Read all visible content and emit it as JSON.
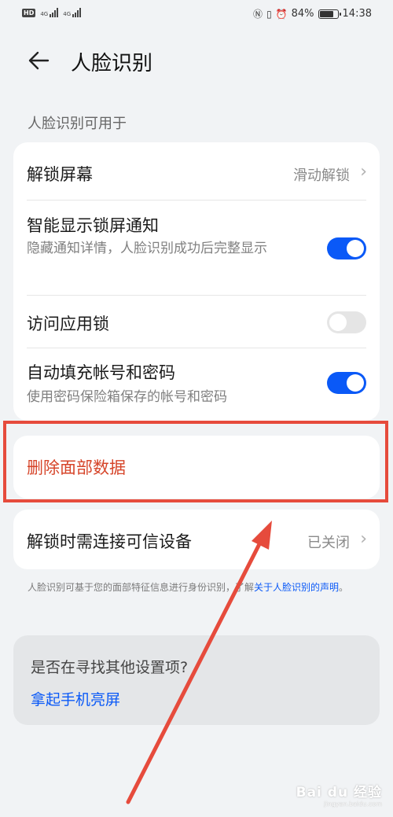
{
  "status_bar": {
    "network_a": "4G",
    "network_b": "4G",
    "battery_percent_text": "84%",
    "battery_level": 0.84,
    "time": "14:38"
  },
  "header": {
    "title": "人脸识别"
  },
  "section": {
    "label": "人脸识别可用于"
  },
  "settings": {
    "unlock_screen": {
      "title": "解锁屏幕",
      "value": "滑动解锁"
    },
    "smart_notify": {
      "title": "智能显示锁屏通知",
      "subtitle": "隐藏通知详情，人脸识别成功后完整显示",
      "enabled": true
    },
    "app_lock": {
      "title": "访问应用锁",
      "enabled": false
    },
    "autofill": {
      "title": "自动填充帐号和密码",
      "subtitle": "使用密码保险箱保存的帐号和密码",
      "enabled": true
    }
  },
  "delete_face": {
    "label": "删除面部数据"
  },
  "trusted_device": {
    "title": "解锁时需连接可信设备",
    "value": "已关闭"
  },
  "disclaimer": {
    "text": "人脸识别可基于您的面部特征信息进行身份识别，了解",
    "link": "关于人脸识别的声明",
    "end": "。"
  },
  "suggestion": {
    "question": "是否在寻找其他设置项?",
    "link": "拿起手机亮屏"
  },
  "watermark": {
    "main": "Bai du 经验",
    "sub": "jingyan.baidu.com"
  },
  "colors": {
    "accent": "#0a59f7",
    "danger": "#d6452a",
    "annotation": "#e64b3c"
  }
}
